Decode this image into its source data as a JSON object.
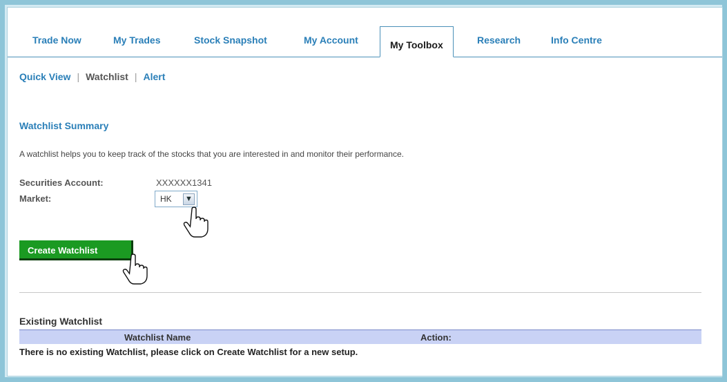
{
  "tabs": [
    {
      "label": "Trade Now"
    },
    {
      "label": "My Trades"
    },
    {
      "label": "Stock Snapshot"
    },
    {
      "label": "My Account"
    },
    {
      "label": "My Toolbox"
    },
    {
      "label": "Research"
    },
    {
      "label": "Info Centre"
    }
  ],
  "subnav": {
    "quick_view": "Quick View",
    "watchlist": "Watchlist",
    "alert": "Alert",
    "separator": "|"
  },
  "summary": {
    "title": "Watchlist Summary",
    "description": "A watchlist helps you to keep track of the stocks that you are interested in and monitor their performance."
  },
  "form": {
    "account_label": "Securities Account:",
    "account_value": "XXXXXX1341",
    "market_label": "Market:",
    "market_value": "HK"
  },
  "create_button": "Create Watchlist",
  "existing": {
    "title": "Existing Watchlist",
    "col_name": "Watchlist Name",
    "col_action": "Action:",
    "empty_message": "There is no existing Watchlist, please click on Create Watchlist for a new setup."
  },
  "colors": {
    "link": "#2a7fb8",
    "button_green": "#1b9a22",
    "table_header": "#c9d2f5"
  }
}
